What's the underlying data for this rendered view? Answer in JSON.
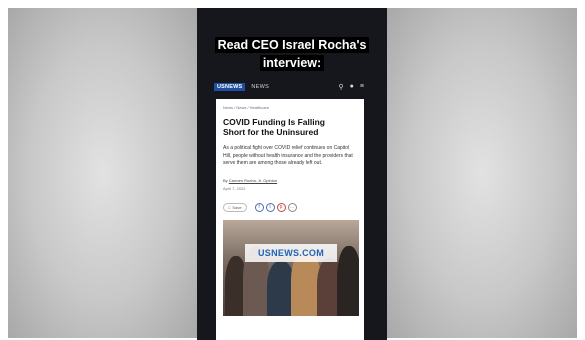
{
  "caption": {
    "line1": "Read CEO Israel Rocha's",
    "line2": "interview:"
  },
  "navbar": {
    "logo_text": "USNEWS",
    "section_label": "NEWS",
    "icons": [
      "search-icon",
      "user-icon",
      "menu-icon"
    ]
  },
  "article": {
    "breadcrumbs": "News / News / Healthcare",
    "headline": "COVID Funding Is Falling Short for the Uninsured",
    "dek": "As a political fight over COVID relief continues on Capitol Hill, people without health insurance and the providers that serve them are among those already left out.",
    "byline_prefix": "By",
    "author": "Carmen Rocha, Jr. Opinion",
    "date": "April 7, 2022",
    "save_label": "Save",
    "share_icons": [
      "facebook-icon",
      "twitter-icon",
      "pinterest-icon",
      "more-icon"
    ],
    "share_glyphs": [
      "f",
      "t",
      "p",
      "…"
    ],
    "photo_watermark": "USNEWS.COM"
  },
  "colors": {
    "phone_bg": "#15171c",
    "logo_blue": "#1f4fa3",
    "watermark_blue": "#1e63b8"
  }
}
